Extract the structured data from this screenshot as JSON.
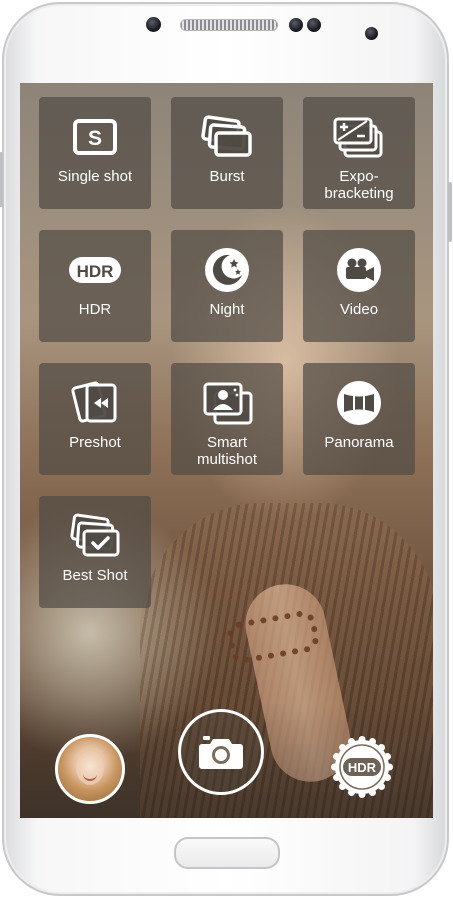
{
  "modes": {
    "single_shot": "Single shot",
    "burst": "Burst",
    "expo_bracketing": "Expo-\nbracketing",
    "hdr": "HDR",
    "night": "Night",
    "video": "Video",
    "preshot": "Preshot",
    "smart_multishot": "Smart\nmultishot",
    "panorama": "Panorama",
    "best_shot": "Best Shot"
  },
  "icons": {
    "single_shot": "single-shot-icon",
    "burst": "burst-icon",
    "expo_bracketing": "exposure-bracketing-icon",
    "hdr": "hdr-icon",
    "night": "night-moon-icon",
    "video": "video-camera-icon",
    "preshot": "preshot-icon",
    "smart_multishot": "smart-multishot-icon",
    "panorama": "panorama-icon",
    "best_shot": "best-shot-icon",
    "shutter": "camera-icon",
    "hdr_toggle": "hdr-badge-icon"
  },
  "icon_text": {
    "single_shot": "S",
    "hdr": "HDR",
    "hdr_toggle": "HDR"
  },
  "colors": {
    "tile_bg": "#504a44",
    "icon": "#ffffff"
  }
}
